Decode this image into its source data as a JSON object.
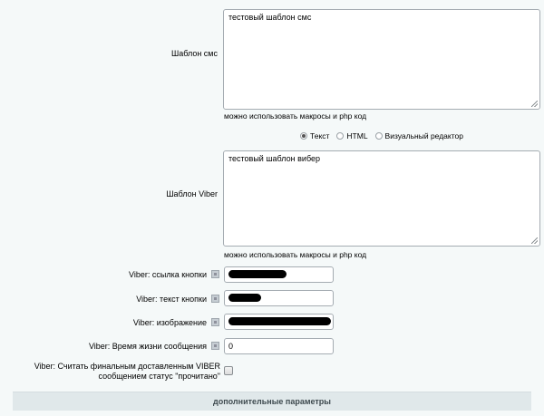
{
  "sms": {
    "label": "Шаблон смс",
    "value": "тестовый шаблон смс",
    "hint": "можно использовать макросы и php код"
  },
  "format": {
    "options": [
      "Текст",
      "HTML",
      "Визуальный редактор"
    ],
    "selected": "Текст"
  },
  "viber": {
    "label": "Шаблон Viber",
    "value": "тестовый шаблон вибер",
    "hint": "можно использовать макросы и php код"
  },
  "fields": {
    "button_link_label": "Viber: ссылка кнопки",
    "button_text_label": "Viber: текст кнопки",
    "image_label": "Viber: изображение",
    "ttl_label": "Viber: Время жизни сообщения",
    "ttl_value": "0",
    "read_label_line1": "Viber: Считать финальным доставленным VIBER",
    "read_label_line2": "сообщением статус \"прочитано\""
  },
  "section": {
    "title": "дополнительные параметры"
  }
}
